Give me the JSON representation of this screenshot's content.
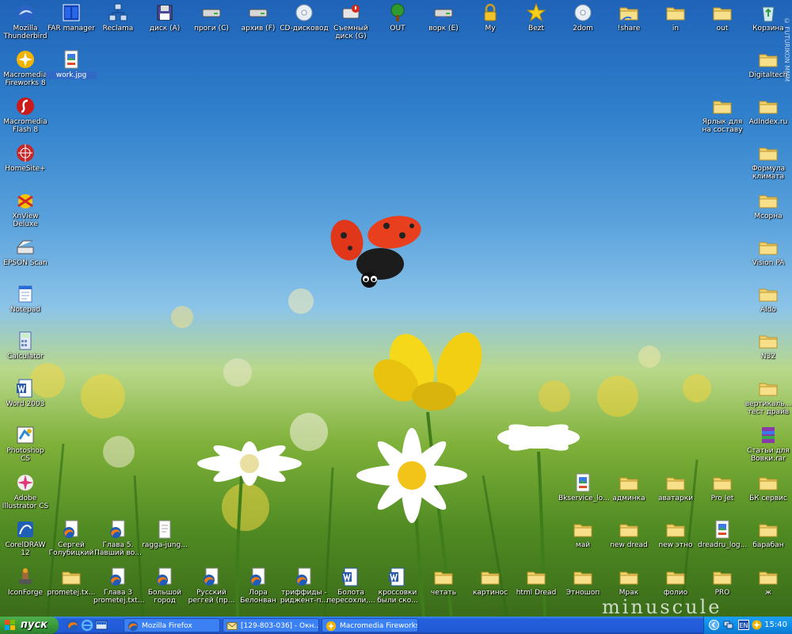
{
  "desktop": {
    "icons": [
      {
        "label": "Mozilla Thunderbird",
        "type": "thunderbird"
      },
      {
        "label": "FAR manager",
        "type": "far"
      },
      {
        "label": "Reclama",
        "type": "network"
      },
      {
        "label": "диск (A)",
        "type": "floppy"
      },
      {
        "label": "проги (C)",
        "type": "drive"
      },
      {
        "label": "архив (F)",
        "type": "drive"
      },
      {
        "label": "CD-дисковод",
        "type": "cdrom"
      },
      {
        "label": "Съемный диск (G)",
        "type": "removable"
      },
      {
        "label": "OUT",
        "type": "tree"
      },
      {
        "label": "ворк (E)",
        "type": "drive-share"
      },
      {
        "label": "My",
        "type": "lock"
      },
      {
        "label": "Bezt",
        "type": "star"
      },
      {
        "label": "2dom",
        "type": "disc"
      },
      {
        "label": "!share",
        "type": "folder-share"
      },
      {
        "label": "in",
        "type": "folder"
      },
      {
        "label": "out",
        "type": "folder"
      },
      {
        "label": "Корзина",
        "type": "recycle"
      },
      {
        "label": "Macromedia Fireworks 8",
        "type": "fireworks"
      },
      {
        "label": "work.jpg",
        "type": "image-file",
        "selected": true
      },
      {
        "label": "Digitaltech",
        "type": "folder"
      },
      {
        "label": "Macromedia Flash 8",
        "type": "flash"
      },
      {
        "label": "Ярлык для на составу",
        "type": "folder"
      },
      {
        "label": "AdIndex.ru",
        "type": "folder"
      },
      {
        "label": "HomeSite+",
        "type": "homesite"
      },
      {
        "label": "Формула климата",
        "type": "folder"
      },
      {
        "label": "XnView Deluxe",
        "type": "xnview"
      },
      {
        "label": "Мсорна",
        "type": "folder"
      },
      {
        "label": "EPSON Scan",
        "type": "scanner"
      },
      {
        "label": "Vision PA",
        "type": "folder"
      },
      {
        "label": "Notepad",
        "type": "notepad"
      },
      {
        "label": "Aldo",
        "type": "folder"
      },
      {
        "label": "Calculator",
        "type": "calculator"
      },
      {
        "label": "N32",
        "type": "folder"
      },
      {
        "label": "Word 2003",
        "type": "word"
      },
      {
        "label": "вертикаль... тест драйв",
        "type": "folder"
      },
      {
        "label": "Photoshop CS",
        "type": "photoshop"
      },
      {
        "label": "Статьи для Вовки.rar",
        "type": "rar"
      },
      {
        "label": "Adobe Illustrator CS",
        "type": "illustrator"
      },
      {
        "label": "Bkservice_lo...",
        "type": "image-file"
      },
      {
        "label": "админка",
        "type": "folder"
      },
      {
        "label": "аватарки",
        "type": "folder"
      },
      {
        "label": "Pro Jet",
        "type": "folder"
      },
      {
        "label": "БК сервис",
        "type": "folder"
      },
      {
        "label": "CorelDRAW 12",
        "type": "corel"
      },
      {
        "label": "Сергей Голубицкий",
        "type": "firefox-doc"
      },
      {
        "label": "Глава 5. Павший во...",
        "type": "firefox-doc"
      },
      {
        "label": "ragga-jung...",
        "type": "file"
      },
      {
        "label": "май",
        "type": "folder"
      },
      {
        "label": "new dread",
        "type": "folder"
      },
      {
        "label": "new этно",
        "type": "folder"
      },
      {
        "label": "dreadru_log...",
        "type": "image-file"
      },
      {
        "label": "барабан",
        "type": "folder"
      },
      {
        "label": "IconForge",
        "type": "iconforge"
      },
      {
        "label": "prometej.tx...",
        "type": "folder"
      },
      {
        "label": "Глава 3 prometej.txt...",
        "type": "firefox-doc"
      },
      {
        "label": "Большой город",
        "type": "firefox-doc"
      },
      {
        "label": "Русский реггей (пр...",
        "type": "firefox-doc"
      },
      {
        "label": "Лора Белонван",
        "type": "firefox-doc"
      },
      {
        "label": "триффиды - риджент-п...",
        "type": "firefox-doc"
      },
      {
        "label": "Болота пересохли,...",
        "type": "word-doc"
      },
      {
        "label": "кроссовки были ско...",
        "type": "word-doc"
      },
      {
        "label": "четать",
        "type": "folder"
      },
      {
        "label": "картинос",
        "type": "folder"
      },
      {
        "label": "html Dread",
        "type": "folder"
      },
      {
        "label": "Этношоп",
        "type": "folder"
      },
      {
        "label": "Мрак",
        "type": "folder"
      },
      {
        "label": "фолио",
        "type": "folder"
      },
      {
        "label": "PRO",
        "type": "folder"
      },
      {
        "label": "ж",
        "type": "folder"
      }
    ],
    "watermark": "minuscule",
    "side_watermark": "© FUTURIKON MMM"
  },
  "taskbar": {
    "start_label": "пуск",
    "quick_launch": [
      {
        "icon": "firefox-icon"
      },
      {
        "icon": "ie-icon"
      },
      {
        "icon": "show-desktop-icon"
      }
    ],
    "tasks": [
      {
        "label": "Mozilla Firefox",
        "icon": "firefox-icon"
      },
      {
        "label": "[129-803-036] - Окн...",
        "icon": "messenger-icon"
      },
      {
        "label": "Macromedia Fireworks 8",
        "icon": "fireworks-icon"
      }
    ],
    "tray": {
      "language": "EN",
      "time": "15:40"
    }
  },
  "colors": {
    "taskbar": "#245edb",
    "start_button": "#3a9a3a",
    "tray": "#118ee8",
    "selection": "#316ac5"
  }
}
